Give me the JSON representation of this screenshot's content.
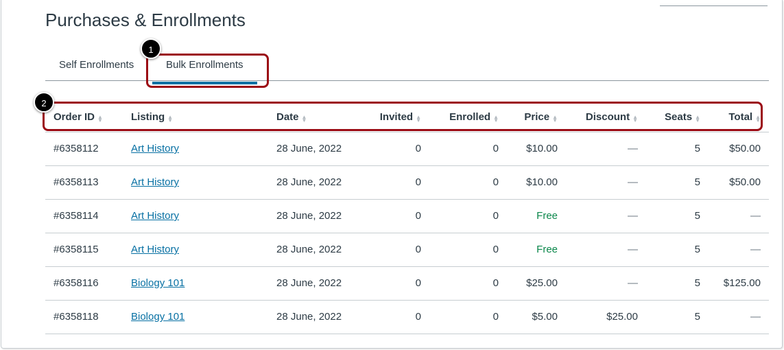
{
  "title": "Purchases & Enrollments",
  "tabs": [
    {
      "label": "Self Enrollments"
    },
    {
      "label": "Bulk Enrollments",
      "active": true
    }
  ],
  "callouts": [
    "1",
    "2"
  ],
  "columns": [
    "Order ID",
    "Listing",
    "Date",
    "Invited",
    "Enrolled",
    "Price",
    "Discount",
    "Seats",
    "Total"
  ],
  "rows": [
    {
      "order": "#6358112",
      "listing": "Art History",
      "date": "28 June, 2022",
      "invited": "0",
      "enrolled": "0",
      "price": "$10.00",
      "discount": "—",
      "seats": "5",
      "total": "$50.00"
    },
    {
      "order": "#6358113",
      "listing": "Art History",
      "date": "28 June, 2022",
      "invited": "0",
      "enrolled": "0",
      "price": "$10.00",
      "discount": "—",
      "seats": "5",
      "total": "$50.00"
    },
    {
      "order": "#6358114",
      "listing": "Art History",
      "date": "28 June, 2022",
      "invited": "0",
      "enrolled": "0",
      "price": "Free",
      "discount": "—",
      "seats": "5",
      "total": "—"
    },
    {
      "order": "#6358115",
      "listing": "Art History",
      "date": "28 June, 2022",
      "invited": "0",
      "enrolled": "0",
      "price": "Free",
      "discount": "—",
      "seats": "5",
      "total": "—"
    },
    {
      "order": "#6358116",
      "listing": "Biology 101",
      "date": "28 June, 2022",
      "invited": "0",
      "enrolled": "0",
      "price": "$25.00",
      "discount": "—",
      "seats": "5",
      "total": "$125.00"
    },
    {
      "order": "#6358118",
      "listing": "Biology 101",
      "date": "28 June, 2022",
      "invited": "0",
      "enrolled": "0",
      "price": "$5.00",
      "discount": "$25.00",
      "seats": "5",
      "total": "—"
    }
  ],
  "colors": {
    "accent": "#0770a3",
    "highlight": "#9b0a14",
    "free": "#0b874b"
  }
}
